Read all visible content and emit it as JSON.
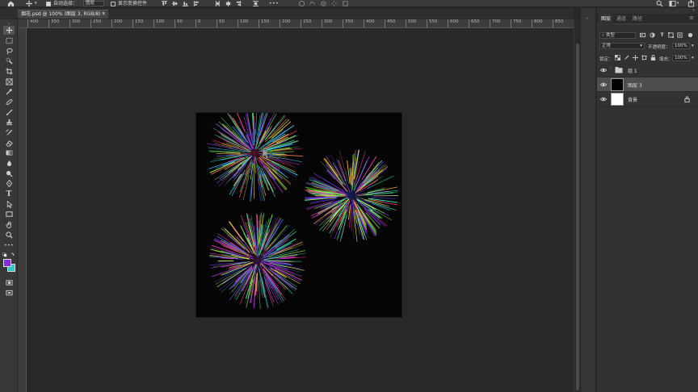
{
  "options_bar": {
    "auto_select_label": "自动选择：",
    "auto_select_value": "图层",
    "show_transform_label": "显示变换控件",
    "more": "•••"
  },
  "document": {
    "tab_title": "烟花.psd @ 100% (图层 3, RGB/8) *",
    "close_glyph": "×"
  },
  "ruler": {
    "h_labels": [
      "400",
      "350",
      "300",
      "250",
      "200",
      "150",
      "100",
      "50",
      "0",
      "50",
      "100",
      "150",
      "200",
      "250",
      "300",
      "350",
      "400",
      "450",
      "500",
      "550",
      "600",
      "650",
      "700",
      "750",
      "800",
      "850",
      "900"
    ]
  },
  "layers_panel": {
    "tabs": [
      {
        "label": "图层",
        "active": true
      },
      {
        "label": "通道",
        "active": false
      },
      {
        "label": "路径",
        "active": false
      }
    ],
    "filter_label": "类型",
    "blend_mode": "正常",
    "opacity_label": "不透明度：",
    "opacity_value": "100%",
    "lock_label": "锁定：",
    "fill_label": "填充：",
    "fill_value": "100%",
    "layers": [
      {
        "name": "组 1",
        "type": "group",
        "visible": true,
        "selected": false
      },
      {
        "name": "图层 3",
        "type": "layer",
        "visible": true,
        "selected": true,
        "thumb_color": "#000000"
      },
      {
        "name": "背景",
        "type": "background",
        "visible": true,
        "selected": false,
        "locked": true,
        "thumb_color": "#ffffff"
      }
    ]
  },
  "colors": {
    "foreground": "#8a2be2",
    "background": "#2ec8c8"
  }
}
